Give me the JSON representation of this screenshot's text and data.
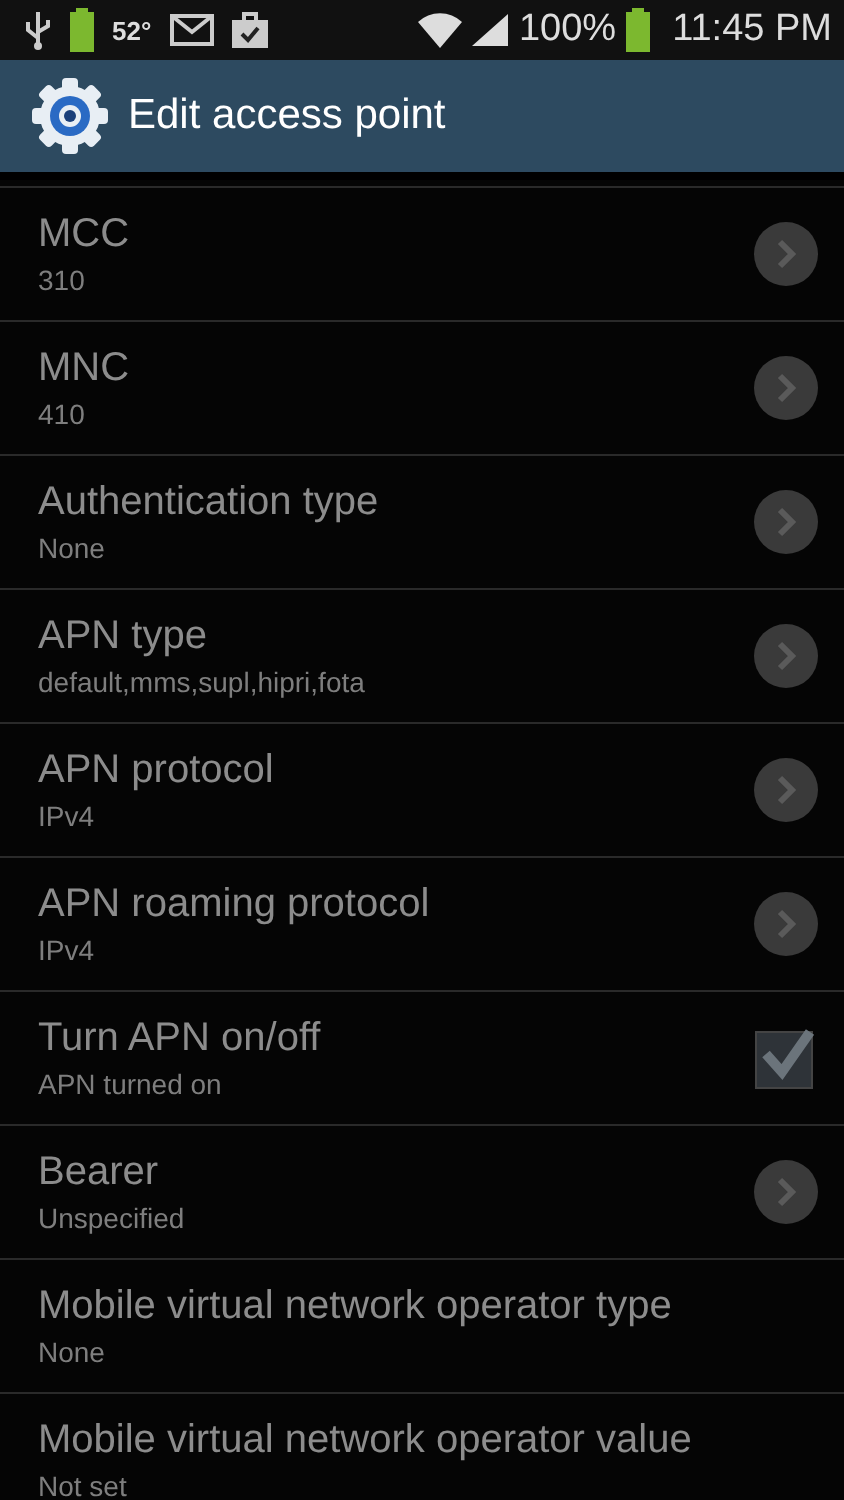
{
  "status_bar": {
    "temperature": "52°",
    "battery_percent": "100%",
    "time": "11:45 PM"
  },
  "header": {
    "title": "Edit access point"
  },
  "rows": [
    {
      "kind": "arrow",
      "title": "MCC",
      "summary": "310",
      "disabled": true
    },
    {
      "kind": "arrow",
      "title": "MNC",
      "summary": "410",
      "disabled": true
    },
    {
      "kind": "arrow",
      "title": "Authentication type",
      "summary": "None",
      "disabled": true
    },
    {
      "kind": "arrow",
      "title": "APN type",
      "summary": "default,mms,supl,hipri,fota",
      "disabled": true
    },
    {
      "kind": "arrow",
      "title": "APN protocol",
      "summary": "IPv4",
      "disabled": true
    },
    {
      "kind": "arrow",
      "title": "APN roaming protocol",
      "summary": "IPv4",
      "disabled": true
    },
    {
      "kind": "checkbox",
      "title": "Turn APN on/off",
      "summary": "APN turned on",
      "checked": true,
      "disabled": true
    },
    {
      "kind": "arrow",
      "title": "Bearer",
      "summary": "Unspecified",
      "disabled": true
    },
    {
      "kind": "plain",
      "title": "Mobile virtual network operator type",
      "summary": "None",
      "disabled": true
    },
    {
      "kind": "plain",
      "title": "Mobile virtual network operator value",
      "summary": "Not set",
      "disabled": true
    }
  ]
}
